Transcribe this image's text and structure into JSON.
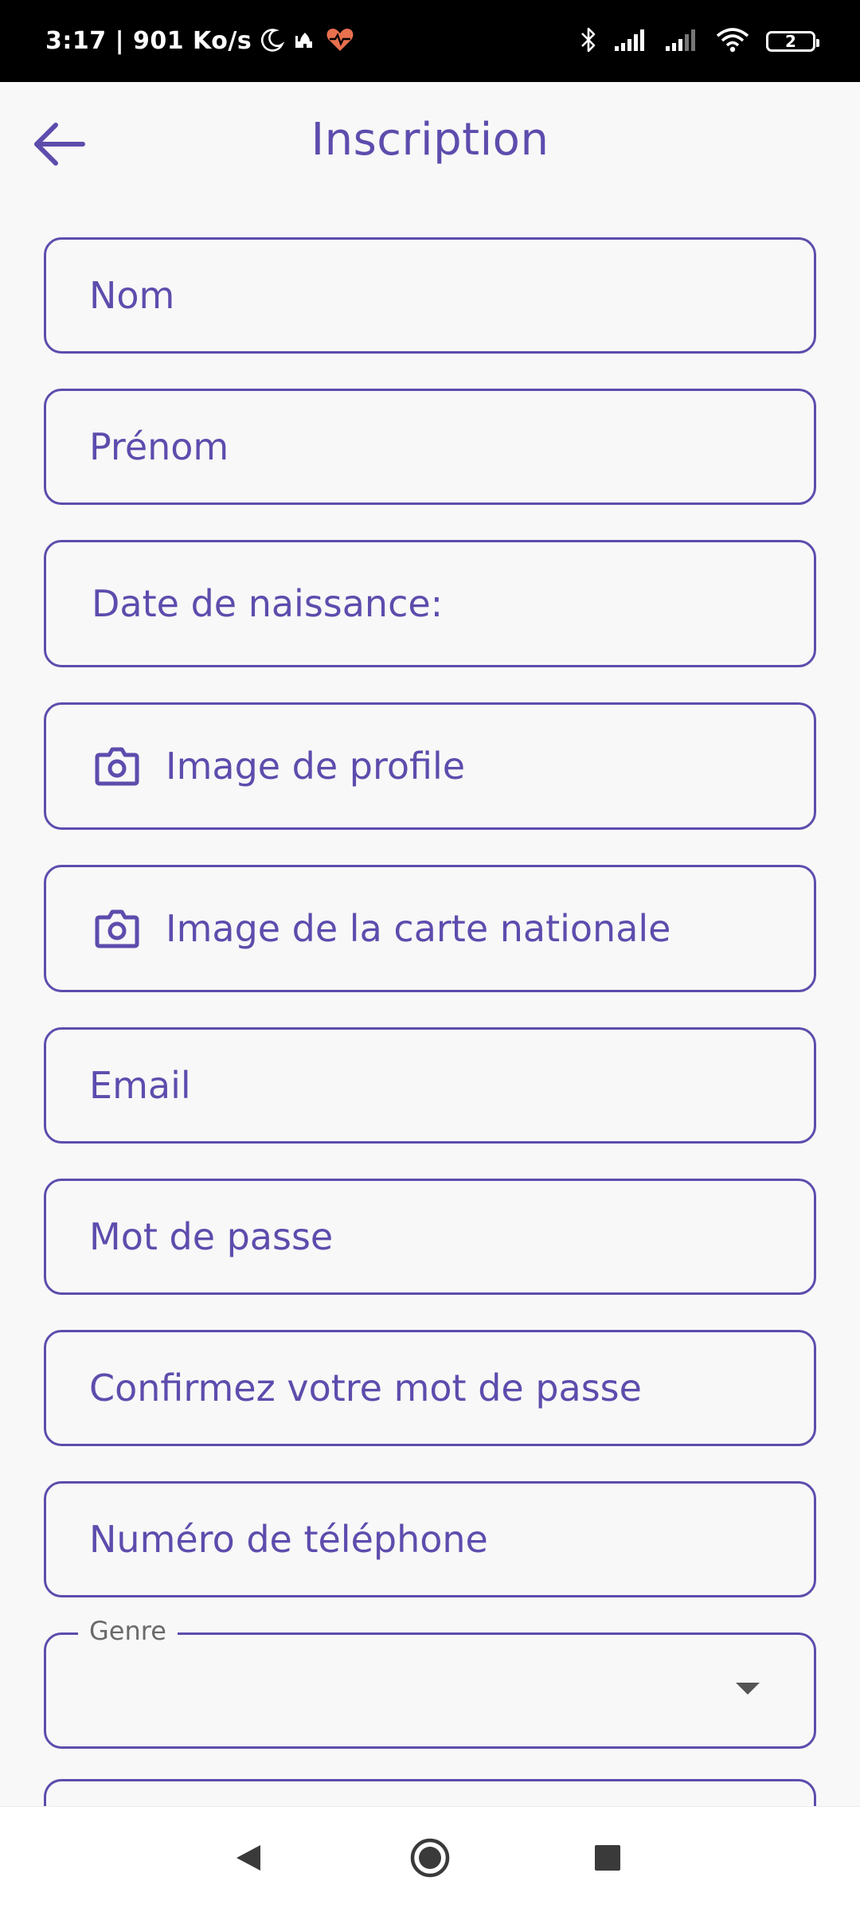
{
  "status_bar": {
    "time_speed": "3:17 | 901 Ko/s",
    "battery_level": "2"
  },
  "app_bar": {
    "title": "Inscription",
    "back_icon": "arrow-back-icon"
  },
  "form": {
    "fields": {
      "nom": "Nom",
      "prenom": "Prénom",
      "date_naissance": "Date de naissance:",
      "image_profile": "Image de profile",
      "image_carte": "Image de la carte nationale",
      "email": "Email",
      "mot_de_passe": "Mot de passe",
      "confirmez": "Confirmez votre mot de passe",
      "telephone": "Numéro de téléphone"
    },
    "genre": {
      "label": "Genre",
      "value": ""
    }
  },
  "colors": {
    "accent": "#5e4cad",
    "background": "#f8f8f8",
    "status_bar": "#000000"
  },
  "nav_bar": {
    "back": "nav-back-icon",
    "home": "nav-home-icon",
    "recents": "nav-recents-icon"
  }
}
